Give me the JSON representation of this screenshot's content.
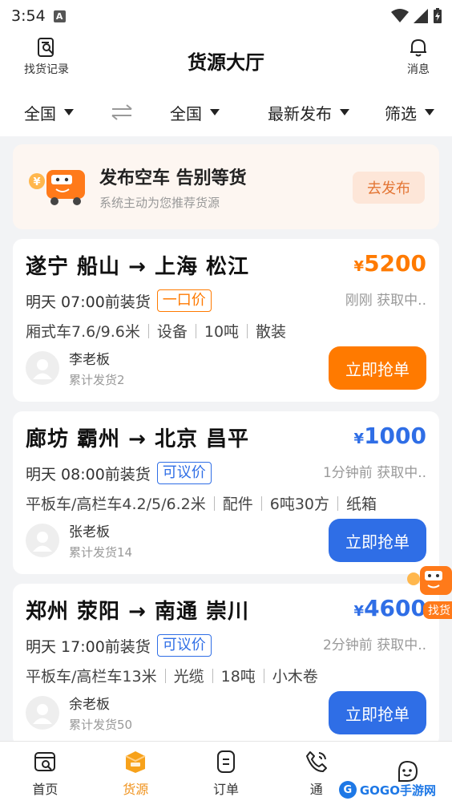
{
  "status_bar": {
    "time": "3:54",
    "badge": "A"
  },
  "header": {
    "title": "货源大厅",
    "left_label": "找货记录",
    "right_label": "消息"
  },
  "filters": {
    "from": "全国",
    "to": "全国",
    "sort": "最新发布",
    "filter": "筛选"
  },
  "banner": {
    "title": "发布空车 告别等货",
    "subtitle": "系统主动为您推荐货源",
    "button": "去发布"
  },
  "cards": [
    {
      "route": "遂宁 船山 → 上海 松江",
      "currency": "¥",
      "price": "5200",
      "load_time": "明天 07:00前装货",
      "tag": "一口价",
      "status": "刚刚 获取中..",
      "specs": [
        "厢式车7.6/9.6米",
        "设备",
        "10吨",
        "散装"
      ],
      "owner": "李老板",
      "shipments": "累计发货2",
      "button": "立即抢单",
      "accent": "#ff7a00"
    },
    {
      "route": "廊坊 霸州 → 北京 昌平",
      "currency": "¥",
      "price": "1000",
      "load_time": "明天 08:00前装货",
      "tag": "可议价",
      "status": "1分钟前 获取中..",
      "specs": [
        "平板车/高栏车4.2/5/6.2米",
        "配件",
        "6吨30方",
        "纸箱"
      ],
      "owner": "张老板",
      "shipments": "累计发货14",
      "button": "立即抢单",
      "accent": "#2f6ee6"
    },
    {
      "route": "郑州 荥阳 → 南通 崇川",
      "currency": "¥",
      "price": "4600",
      "load_time": "明天 17:00前装货",
      "tag": "可议价",
      "status": "2分钟前 获取中..",
      "specs": [
        "平板车/高栏车13米",
        "光缆",
        "18吨",
        "小木卷"
      ],
      "owner": "余老板",
      "shipments": "累计发货50",
      "button": "立即抢单",
      "accent": "#2f6ee6"
    }
  ],
  "float_helper": {
    "label": "找货"
  },
  "tabs": [
    {
      "label": "首页",
      "icon": "home-icon"
    },
    {
      "label": "货源",
      "icon": "cargo-icon"
    },
    {
      "label": "订单",
      "icon": "order-icon"
    },
    {
      "label": "通",
      "icon": "phone-icon"
    },
    {
      "label": "",
      "icon": "profile-icon"
    }
  ],
  "watermark": {
    "logo": "G",
    "text": "GOGO手游网"
  },
  "colors": {
    "orange": "#ff7a00",
    "blue": "#2f6ee6",
    "tab_active": "#f0911a"
  }
}
